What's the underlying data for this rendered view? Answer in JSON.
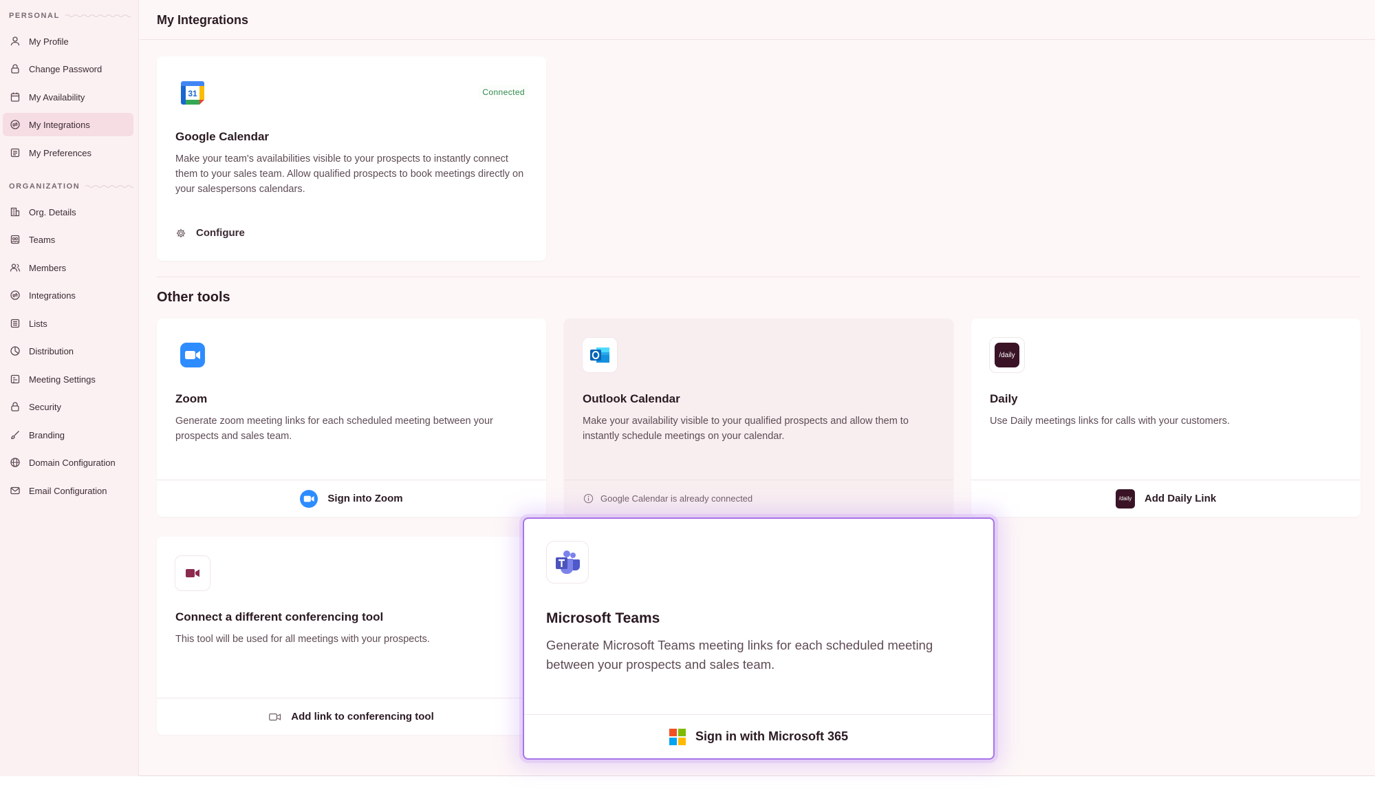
{
  "sidebar": {
    "personal_label": "PERSONAL",
    "personal_items": [
      {
        "label": "My Profile",
        "icon": "user-icon"
      },
      {
        "label": "Change Password",
        "icon": "lock-icon"
      },
      {
        "label": "My Availability",
        "icon": "calendar-icon"
      },
      {
        "label": "My Integrations",
        "icon": "integrations-icon"
      },
      {
        "label": "My Preferences",
        "icon": "preferences-icon"
      }
    ],
    "organization_label": "ORGANIZATION",
    "org_items": [
      {
        "label": "Org. Details",
        "icon": "building-icon"
      },
      {
        "label": "Teams",
        "icon": "teams-icon"
      },
      {
        "label": "Members",
        "icon": "members-icon"
      },
      {
        "label": "Integrations",
        "icon": "integrations-icon"
      },
      {
        "label": "Lists",
        "icon": "list-icon"
      },
      {
        "label": "Distribution",
        "icon": "pie-icon"
      },
      {
        "label": "Meeting Settings",
        "icon": "settings-icon"
      },
      {
        "label": "Security",
        "icon": "lock-icon"
      },
      {
        "label": "Branding",
        "icon": "brush-icon"
      },
      {
        "label": "Domain Configuration",
        "icon": "globe-icon"
      },
      {
        "label": "Email Configuration",
        "icon": "mail-icon"
      }
    ]
  },
  "header": {
    "title": "My Integrations"
  },
  "google_calendar": {
    "title": "Google Calendar",
    "status": "Connected",
    "description": "Make your team's availabilities visible to your prospects to instantly connect them to your sales team. Allow qualified prospects to book meetings directly on your salespersons calendars.",
    "configure_label": "Configure",
    "icon_text": "31"
  },
  "other_tools": {
    "title": "Other tools",
    "zoom": {
      "title": "Zoom",
      "description": "Generate zoom meeting links for each scheduled meeting between your prospects and sales team.",
      "action": "Sign into Zoom"
    },
    "outlook": {
      "title": "Outlook Calendar",
      "description": "Make your availability visible to your qualified prospects and allow them to instantly schedule meetings on your calendar.",
      "note": "Google Calendar is already connected"
    },
    "daily": {
      "title": "Daily",
      "description": "Use Daily meetings links for calls with your customers.",
      "action": "Add Daily Link",
      "logo_text": "/daily"
    },
    "custom": {
      "title": "Connect a different conferencing tool",
      "description": "This tool will be used for all meetings with your prospects.",
      "action": "Add link to conferencing tool"
    },
    "teams": {
      "title": "Microsoft Teams",
      "description": "Generate Microsoft Teams meeting links for each scheduled meeting between your prospects and sales team.",
      "action": "Sign in with Microsoft 365"
    }
  },
  "colors": {
    "accent_highlight": "#a874e8",
    "connected": "#2f8a4b",
    "zoom_blue": "#2d8cff",
    "daily_bg": "#3a1426"
  }
}
